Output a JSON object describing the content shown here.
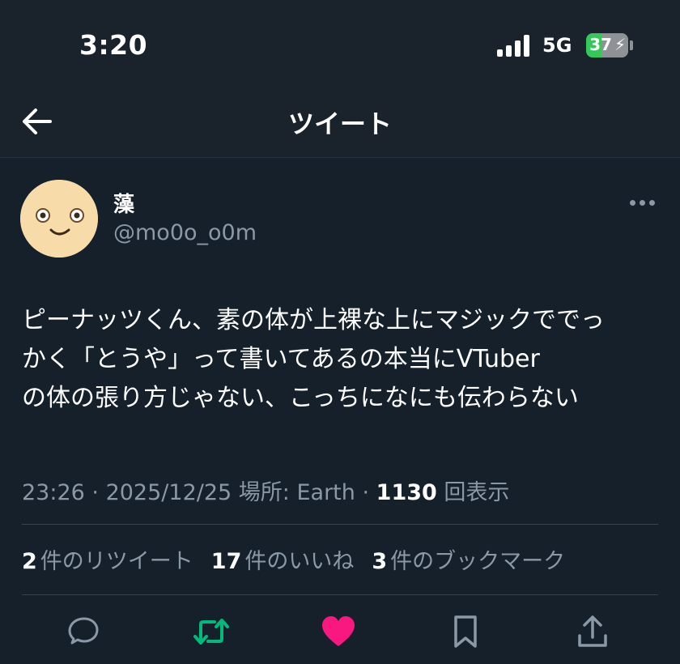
{
  "status_bar": {
    "time": "3:20",
    "network": "5G",
    "battery": "37",
    "battery_level": 0.37
  },
  "header": {
    "title": "ツイート"
  },
  "author": {
    "display_name": "藻",
    "handle": "@mo0o_o0m"
  },
  "tweet": {
    "lines": [
      "ピーナッツくん、素の体が上裸な上にマジックででっ",
      "かく「とうや」って書いてあるの本当にVTuber",
      "の体の張り方じゃない、こっちになにも伝わらない"
    ],
    "time": "23:26",
    "date": "2025/12/25",
    "location": "場所: Earth",
    "view_count": "1130",
    "view_label": "回表示"
  },
  "stats": {
    "retweets_count": "2",
    "retweets_label": "件のリツイート",
    "likes_count": "17",
    "likes_label": "件のいいね",
    "bookmarks_count": "3",
    "bookmarks_label": "件のブックマーク"
  },
  "colors": {
    "background": "#15202b",
    "secondary_text": "#8b98a5",
    "retweet_green": "#00ba7c",
    "like_pink": "#f91880",
    "battery_green": "#34c759"
  },
  "icons": {
    "back": "arrow-left-icon",
    "more": "more-dots-icon",
    "reply": "reply-bubble-icon",
    "retweet": "retweet-icon",
    "like": "heart-icon",
    "bookmark": "bookmark-icon",
    "share": "share-icon"
  }
}
